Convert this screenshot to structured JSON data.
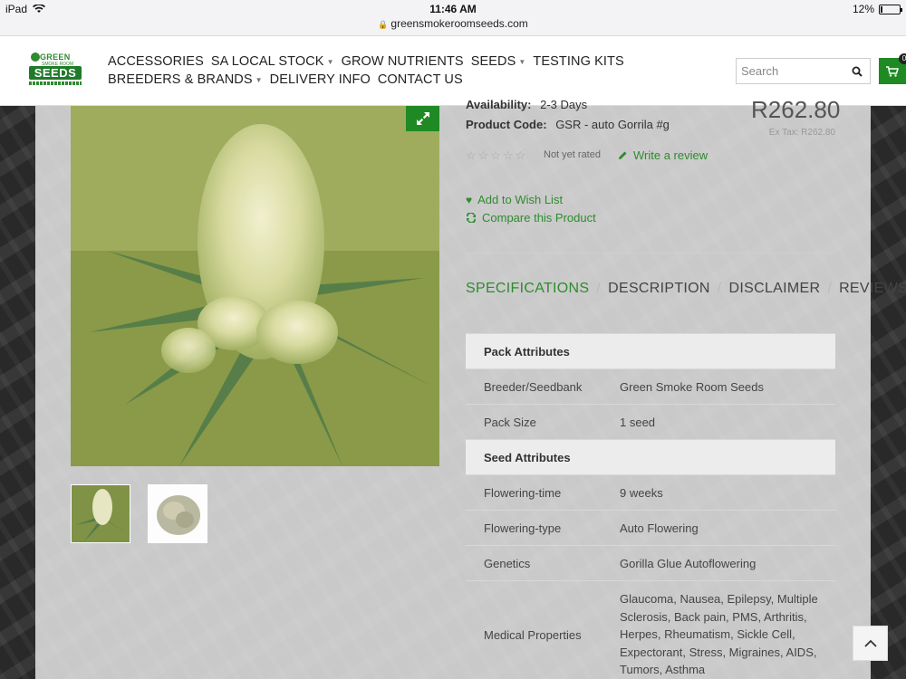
{
  "status_bar": {
    "device": "iPad",
    "time": "11:46 AM",
    "url": "greensmokeroomseeds.com",
    "battery": "12%",
    "battery_level": 0.12
  },
  "header": {
    "logo": {
      "line1": "GREEN",
      "line2": "SMOKE ROOM",
      "main": "SEEDS"
    },
    "nav_row1": [
      {
        "label": "ACCESSORIES",
        "has_dropdown": false
      },
      {
        "label": "SA LOCAL STOCK",
        "has_dropdown": true
      },
      {
        "label": "GROW NUTRIENTS",
        "has_dropdown": false
      },
      {
        "label": "SEEDS",
        "has_dropdown": true
      },
      {
        "label": "TESTING KITS",
        "has_dropdown": false
      }
    ],
    "nav_row2": [
      {
        "label": "BREEDERS & BRANDS",
        "has_dropdown": true
      },
      {
        "label": "DELIVERY INFO",
        "has_dropdown": false
      },
      {
        "label": "CONTACT US",
        "has_dropdown": false
      }
    ],
    "search": {
      "placeholder": "Search",
      "value": ""
    },
    "cart_count": "0",
    "accent_color": "#1f8a23"
  },
  "product": {
    "availability_label": "Availability:",
    "availability_value": "2-3 Days",
    "code_label": "Product Code:",
    "code_value": "GSR - auto Gorrila #g",
    "price": "R262.80",
    "ex_tax": "Ex Tax: R262.80",
    "rating_text": "Not yet rated",
    "write_review": "Write a review",
    "add_to_wishlist": "Add to Wish List",
    "compare": "Compare this Product"
  },
  "tabs": {
    "items": [
      "SPECIFICATIONS",
      "DESCRIPTION",
      "DISCLAIMER",
      "REVIEWS"
    ],
    "active": "SPECIFICATIONS"
  },
  "specs": {
    "group1": "Pack Attributes",
    "breeder_label": "Breeder/Seedbank",
    "breeder_value": "Green Smoke Room Seeds",
    "pack_size_label": "Pack Size",
    "pack_size_value": "1 seed",
    "group2": "Seed Attributes",
    "flowering_time_label": "Flowering-time",
    "flowering_time_value": "9 weeks",
    "flowering_type_label": "Flowering-type",
    "flowering_type_value": "Auto Flowering",
    "genetics_label": "Genetics",
    "genetics_value": "Gorilla Glue Autoflowering",
    "medical_label": "Medical Properties",
    "medical_value": "Glaucoma, Nausea, Epilepsy, Multiple Sclerosis, Back pain, PMS, Arthritis, Herpes, Rheumatism, Sickle Cell, Expectorant, Stress, Migraines, AIDS, Tumors, Asthma"
  }
}
